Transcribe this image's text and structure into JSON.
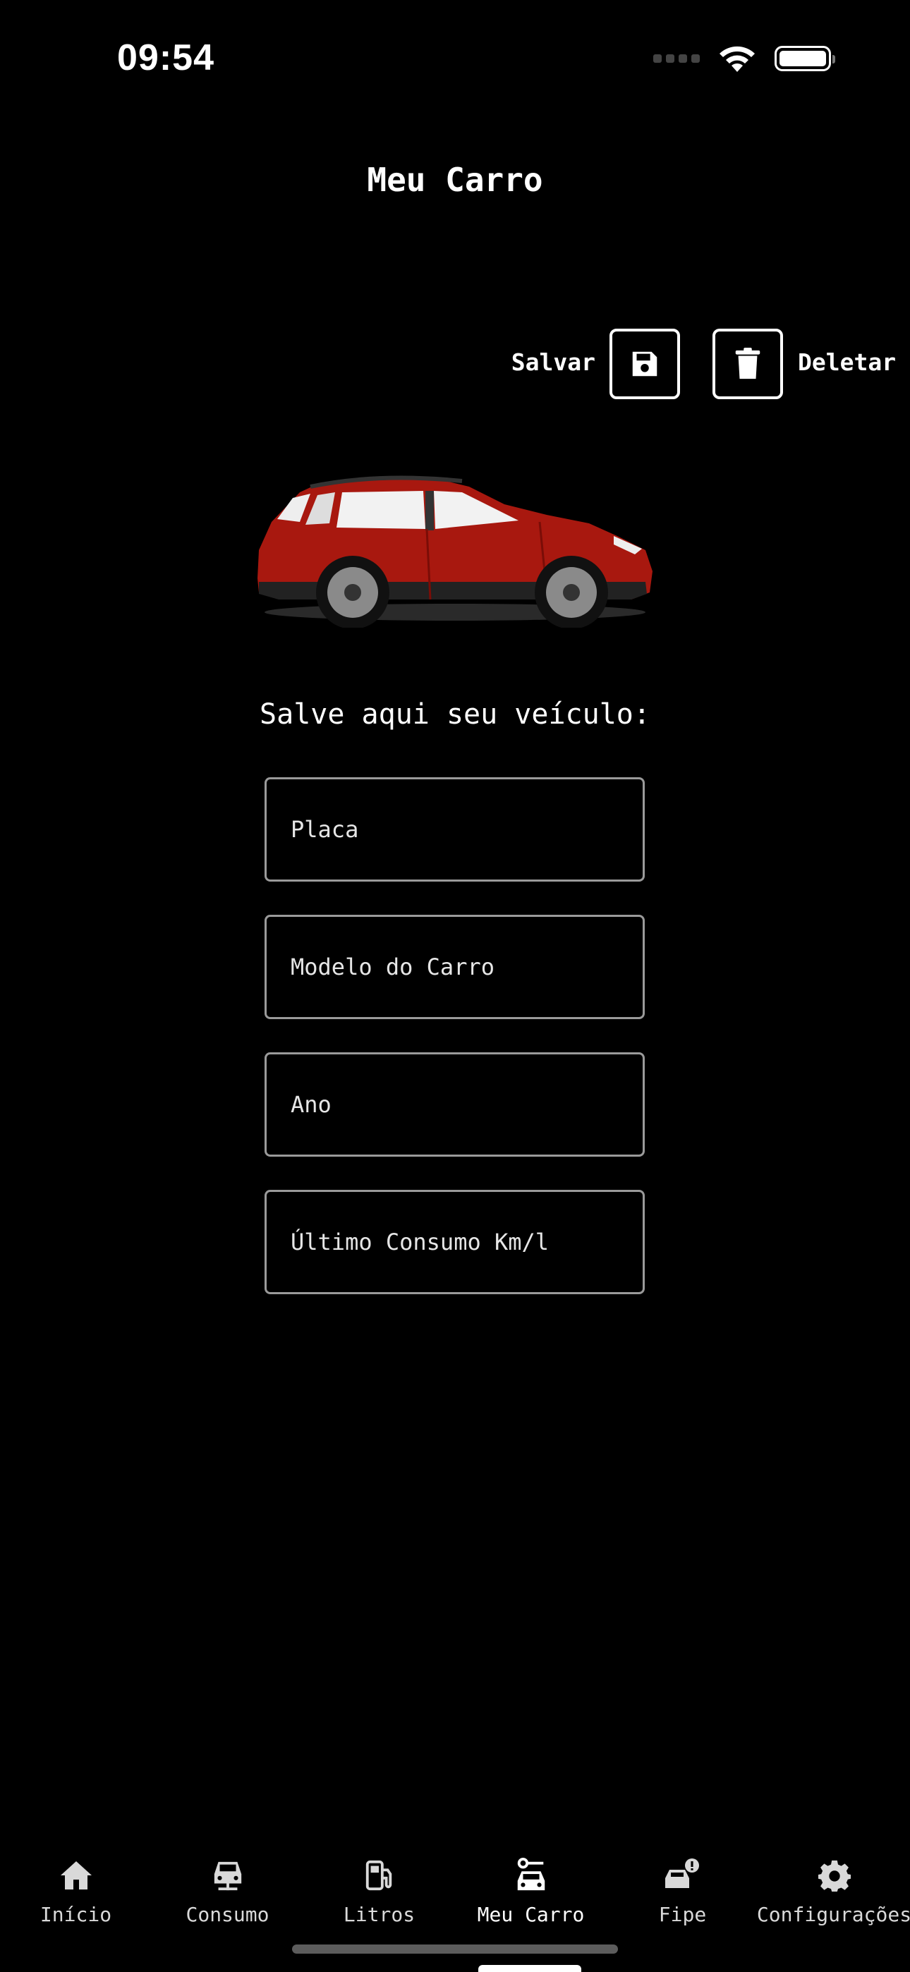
{
  "status": {
    "time": "09:54"
  },
  "header": {
    "title": "Meu Carro"
  },
  "actions": {
    "save_label": "Salvar",
    "delete_label": "Deletar"
  },
  "form": {
    "heading": "Salve aqui seu veículo:",
    "plate_placeholder": "Placa",
    "model_placeholder": "Modelo do Carro",
    "year_placeholder": "Ano",
    "consumption_placeholder": "Último Consumo Km/l"
  },
  "tabs": [
    {
      "label": "Início",
      "icon": "home-icon"
    },
    {
      "label": "Consumo",
      "icon": "car-front-icon"
    },
    {
      "label": "Litros",
      "icon": "fuel-pump-icon"
    },
    {
      "label": "Meu Carro",
      "icon": "car-key-icon",
      "active": true
    },
    {
      "label": "Fipe",
      "icon": "car-alert-icon"
    },
    {
      "label": "Configurações",
      "icon": "gear-icon"
    }
  ],
  "colors": {
    "background": "#000000",
    "foreground": "#ffffff",
    "field_border": "#9a9a9a",
    "car_body": "#a8180f"
  }
}
